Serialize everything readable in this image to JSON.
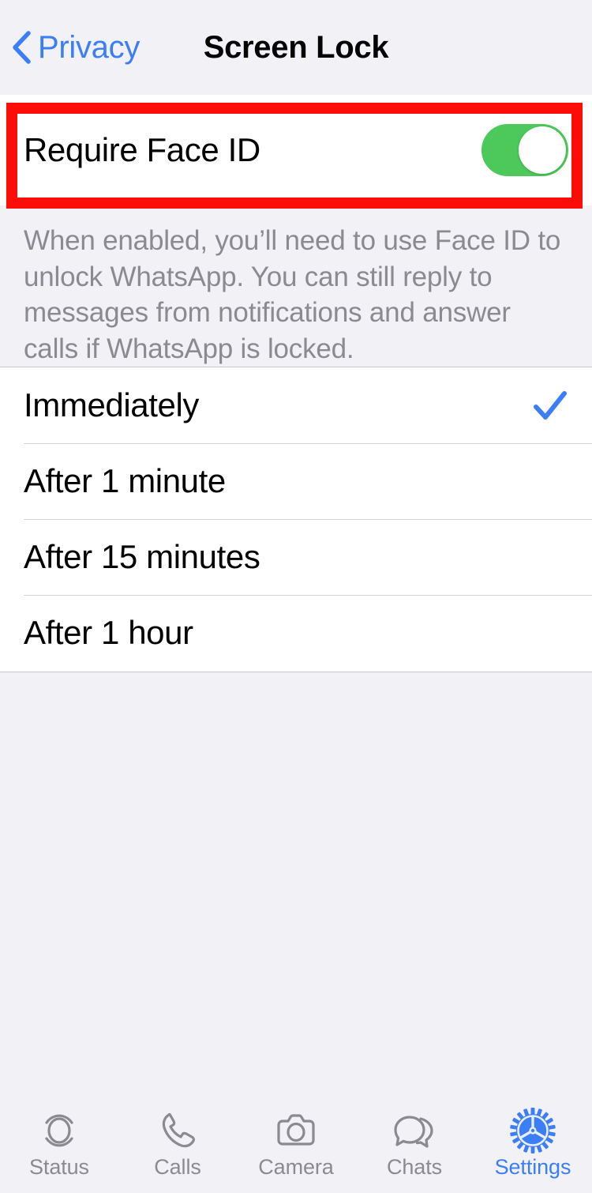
{
  "navbar": {
    "back_label": "Privacy",
    "back_icon": "chevron-left-icon",
    "title": "Screen Lock"
  },
  "toggle_section": {
    "label": "Require Face ID",
    "switch_state": "on",
    "switch_on_color": "#4cc95a",
    "highlight_color": "#fc0d08",
    "description": "When enabled, you’ll need to use Face ID to unlock WhatsApp. You can still reply to messages from notifications and answer calls if WhatsApp is locked."
  },
  "options": {
    "selected": "Immediately",
    "check_icon": "checkmark-icon",
    "check_color": "#3b7ef5",
    "items": [
      {
        "label": "Immediately",
        "checked": true
      },
      {
        "label": "After 1 minute",
        "checked": false
      },
      {
        "label": "After 15 minutes",
        "checked": false
      },
      {
        "label": "After 1 hour",
        "checked": false
      }
    ]
  },
  "tabbar": {
    "active": "Settings",
    "active_color": "#3b7ef5",
    "inactive_color": "#8b8a90",
    "items": [
      {
        "label": "Status",
        "icon": "status-rings-icon"
      },
      {
        "label": "Calls",
        "icon": "phone-handset-icon"
      },
      {
        "label": "Camera",
        "icon": "camera-icon"
      },
      {
        "label": "Chats",
        "icon": "speech-bubbles-icon"
      },
      {
        "label": "Settings",
        "icon": "gear-icon"
      }
    ]
  }
}
